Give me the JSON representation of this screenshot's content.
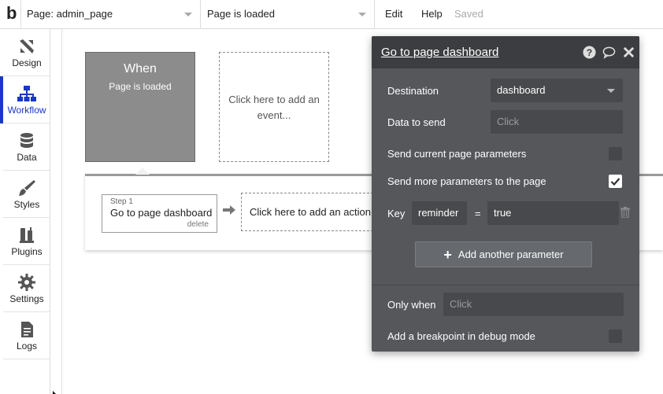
{
  "app": {
    "logo": "b"
  },
  "topbar": {
    "page_selector": "Page: admin_page",
    "event_selector": "Page is loaded",
    "menu": {
      "edit": "Edit",
      "help": "Help",
      "status": "Saved"
    }
  },
  "sidebar": {
    "items": [
      {
        "label": "Design",
        "icon": "design-tools-icon"
      },
      {
        "label": "Workflow",
        "icon": "workflow-icon",
        "active": true
      },
      {
        "label": "Data",
        "icon": "database-icon"
      },
      {
        "label": "Styles",
        "icon": "brush-icon"
      },
      {
        "label": "Plugins",
        "icon": "plug-icon"
      },
      {
        "label": "Settings",
        "icon": "gear-icon"
      },
      {
        "label": "Logs",
        "icon": "document-icon"
      }
    ]
  },
  "canvas": {
    "when_title": "When",
    "when_event": "Page is loaded",
    "add_event": "Click here to add an event...",
    "step": {
      "label": "Step 1",
      "title": "Go to page dashboard",
      "delete": "delete"
    },
    "add_action": "Click here to add an action..."
  },
  "panel": {
    "title": "Go to page dashboard",
    "destination_label": "Destination",
    "destination_value": "dashboard",
    "data_to_send_label": "Data to send",
    "data_to_send_placeholder": "Click",
    "send_current_params_label": "Send current page parameters",
    "send_current_params_checked": false,
    "send_more_params_label": "Send more parameters to the page",
    "send_more_params_checked": true,
    "key_label": "Key",
    "key_value": "reminder",
    "equals": "=",
    "param_value": "true",
    "add_param_label": "Add another parameter",
    "only_when_label": "Only when",
    "only_when_placeholder": "Click",
    "breakpoint_label": "Add a breakpoint in debug mode",
    "breakpoint_checked": false
  },
  "colors": {
    "accent": "#1a37c7",
    "panel_bg": "#55575b",
    "panel_header": "#3b3d40",
    "event_box": "#8c8c8c"
  }
}
